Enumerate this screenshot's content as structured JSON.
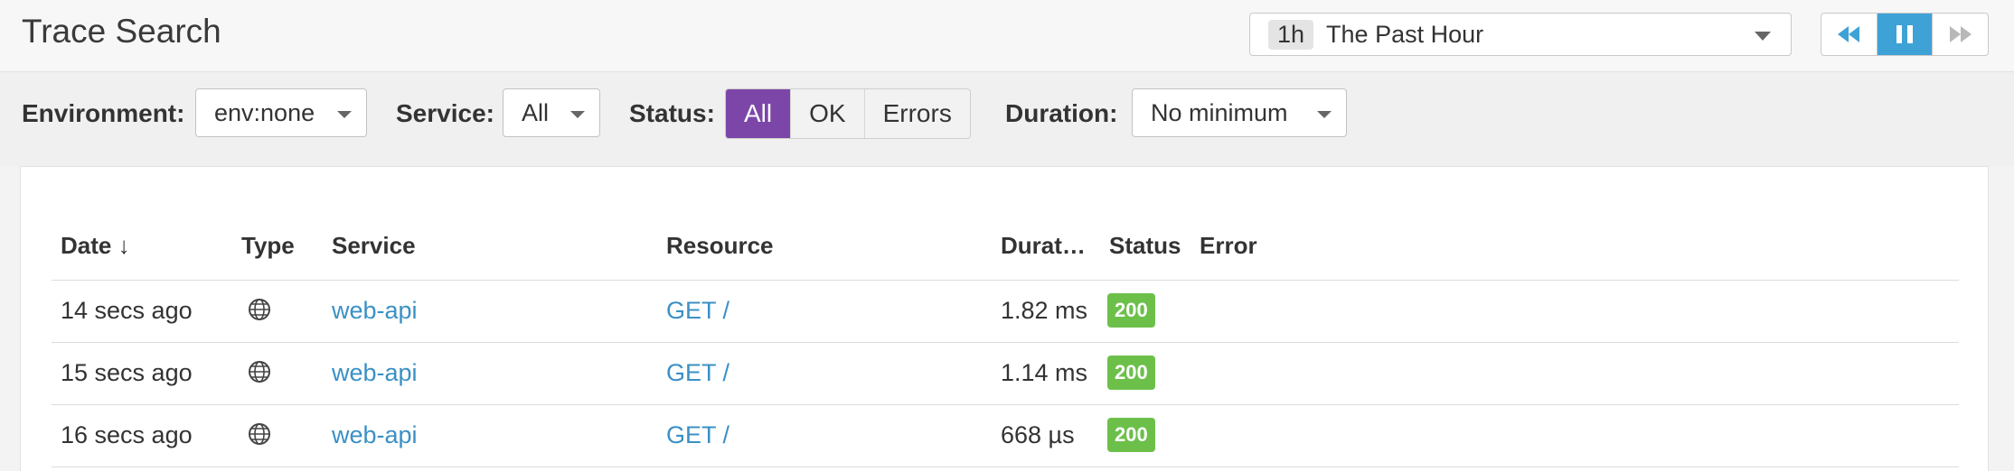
{
  "header": {
    "title": "Trace Search",
    "timeframe": {
      "badge": "1h",
      "label": "The Past Hour"
    },
    "playback": {
      "rewind_icon": "rewind-icon",
      "pause_icon": "pause-icon",
      "forward_icon": "fast-forward-icon"
    }
  },
  "filters": {
    "environment": {
      "label": "Environment:",
      "value": "env:none"
    },
    "service": {
      "label": "Service:",
      "value": "All"
    },
    "status": {
      "label": "Status:",
      "options": [
        "All",
        "OK",
        "Errors"
      ],
      "selected": "All"
    },
    "duration": {
      "label": "Duration:",
      "value": "No minimum"
    }
  },
  "table": {
    "columns": [
      "Date ↓",
      "Type",
      "Service",
      "Resource",
      "Durat…",
      "Status",
      "Error"
    ],
    "rows": [
      {
        "date": "14 secs ago",
        "type_icon": "globe-icon",
        "service": "web-api",
        "resource": "GET /",
        "duration": "1.82 ms",
        "status": "200",
        "error": ""
      },
      {
        "date": "15 secs ago",
        "type_icon": "globe-icon",
        "service": "web-api",
        "resource": "GET /",
        "duration": "1.14 ms",
        "status": "200",
        "error": ""
      },
      {
        "date": "16 secs ago",
        "type_icon": "globe-icon",
        "service": "web-api",
        "resource": "GET /",
        "duration": "668 µs",
        "status": "200",
        "error": ""
      }
    ]
  },
  "colors": {
    "accent": "#7c46a8",
    "link": "#3b90c4",
    "status_ok": "#6cc04a",
    "playback_active": "#3fa2d6"
  }
}
